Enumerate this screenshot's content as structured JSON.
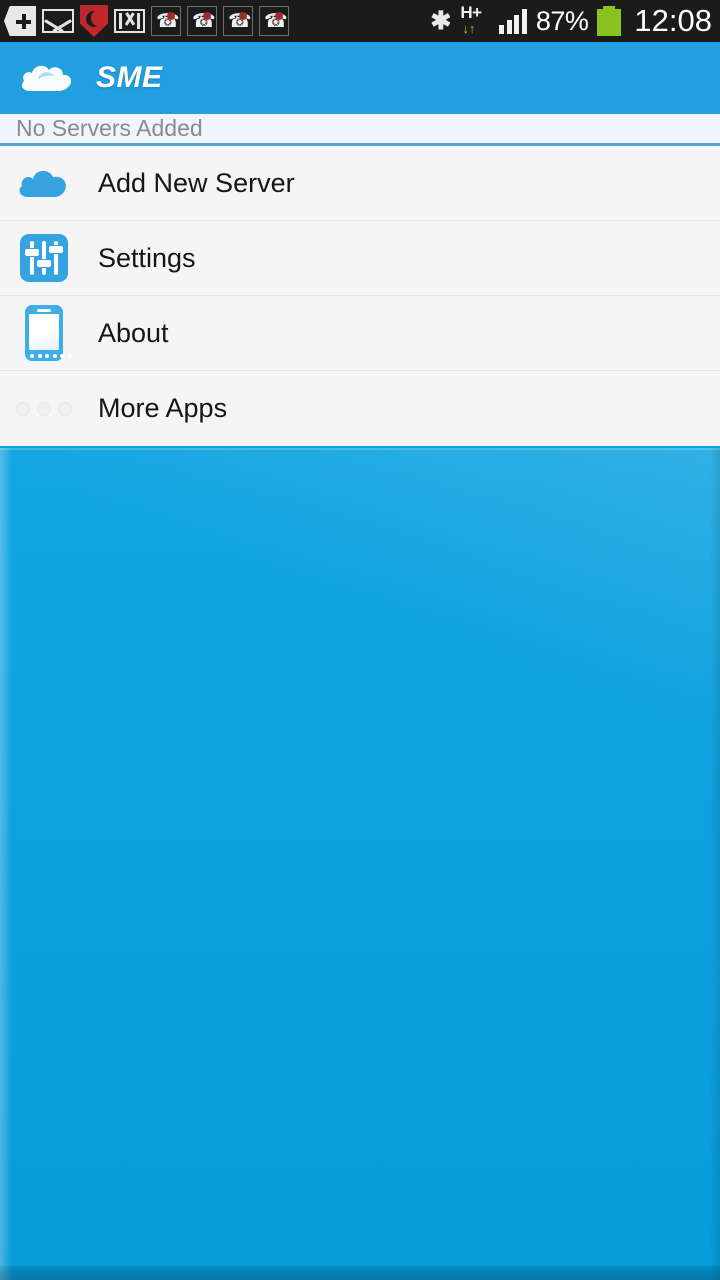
{
  "statusbar": {
    "left_icons": [
      {
        "name": "add-tag-icon",
        "glyph": "+"
      },
      {
        "name": "email-icon",
        "glyph": "envelope"
      },
      {
        "name": "comodo-shield-icon",
        "glyph": "shield"
      },
      {
        "name": "gmail-icon",
        "glyph": "M"
      },
      {
        "name": "missed-call-icon-1",
        "glyph": "call"
      },
      {
        "name": "missed-call-icon-2",
        "glyph": "call"
      },
      {
        "name": "missed-call-icon-3",
        "glyph": "call"
      },
      {
        "name": "missed-call-icon-4",
        "glyph": "call"
      }
    ],
    "bluetooth_glyph": "✱",
    "network_type": "H+",
    "data_down_glyph": "↓",
    "data_up_glyph": "↑",
    "signal_bars": 4,
    "battery_percent": "87%",
    "clock": "12:08"
  },
  "appbar": {
    "title": "SME",
    "logo_name": "cloud-logo",
    "background_color": "#229FE0"
  },
  "section": {
    "header_label": "No Servers Added",
    "header_bg": "#EFF5FC",
    "divider_color": "#4FA8CE"
  },
  "list": {
    "items": [
      {
        "label": "Add New Server",
        "icon": "cloud-icon"
      },
      {
        "label": "Settings",
        "icon": "sliders-icon"
      },
      {
        "label": "About",
        "icon": "smartphone-icon"
      },
      {
        "label": "More Apps",
        "icon": "three-dots-icon"
      }
    ]
  },
  "canvas": {
    "background_color": "#0FA3E0"
  }
}
